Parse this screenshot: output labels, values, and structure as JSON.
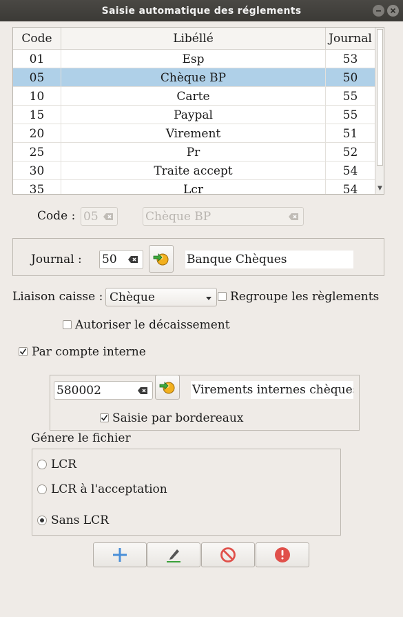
{
  "window": {
    "title": "Saisie automatique des réglements"
  },
  "table": {
    "columns": [
      "Code",
      "Libéllé",
      "Journal"
    ],
    "rows": [
      {
        "code": "01",
        "libelle": "Esp",
        "journal": "53"
      },
      {
        "code": "05",
        "libelle": "Chèque BP",
        "journal": "50"
      },
      {
        "code": "10",
        "libelle": "Carte",
        "journal": "55"
      },
      {
        "code": "15",
        "libelle": "Paypal",
        "journal": "55"
      },
      {
        "code": "20",
        "libelle": "Virement",
        "journal": "51"
      },
      {
        "code": "25",
        "libelle": "Pr",
        "journal": "52"
      },
      {
        "code": "30",
        "libelle": "Traite accept",
        "journal": "54"
      },
      {
        "code": "35",
        "libelle": "Lcr",
        "journal": "54"
      }
    ],
    "selected_row": 1
  },
  "code_section": {
    "label": "Code :",
    "code_value": "05",
    "libelle_value": "Chèque BP"
  },
  "journal_section": {
    "label": "Journal :",
    "value": "50",
    "name": "Banque Chèques"
  },
  "liaison": {
    "label": "Liaison caisse :",
    "selected": "Chèque",
    "regroupe_label": "Regroupe les règlements",
    "regroupe_checked": false
  },
  "autoriser": {
    "label": "Autoriser le décaissement",
    "checked": false
  },
  "par_compte": {
    "label": "Par compte interne",
    "checked": true
  },
  "compte": {
    "value": "580002",
    "name": "Virements internes chèques",
    "saisie_label": "Saisie par bordereaux",
    "saisie_checked": true
  },
  "genere": {
    "label": "Génere le fichier",
    "options": [
      "LCR",
      "LCR à l'acceptation",
      "Sans LCR"
    ],
    "selected": 2
  },
  "icons": {
    "add": "plus-icon",
    "edit": "pencil-icon",
    "cancel": "prohibited-icon",
    "quit": "exit-icon",
    "go": "arrow-go-icon"
  },
  "colors": {
    "selection": "#afd0e8",
    "add_blue": "#4a8fd8",
    "cancel_red": "#e0504a",
    "edit_green": "#3aa03a"
  }
}
